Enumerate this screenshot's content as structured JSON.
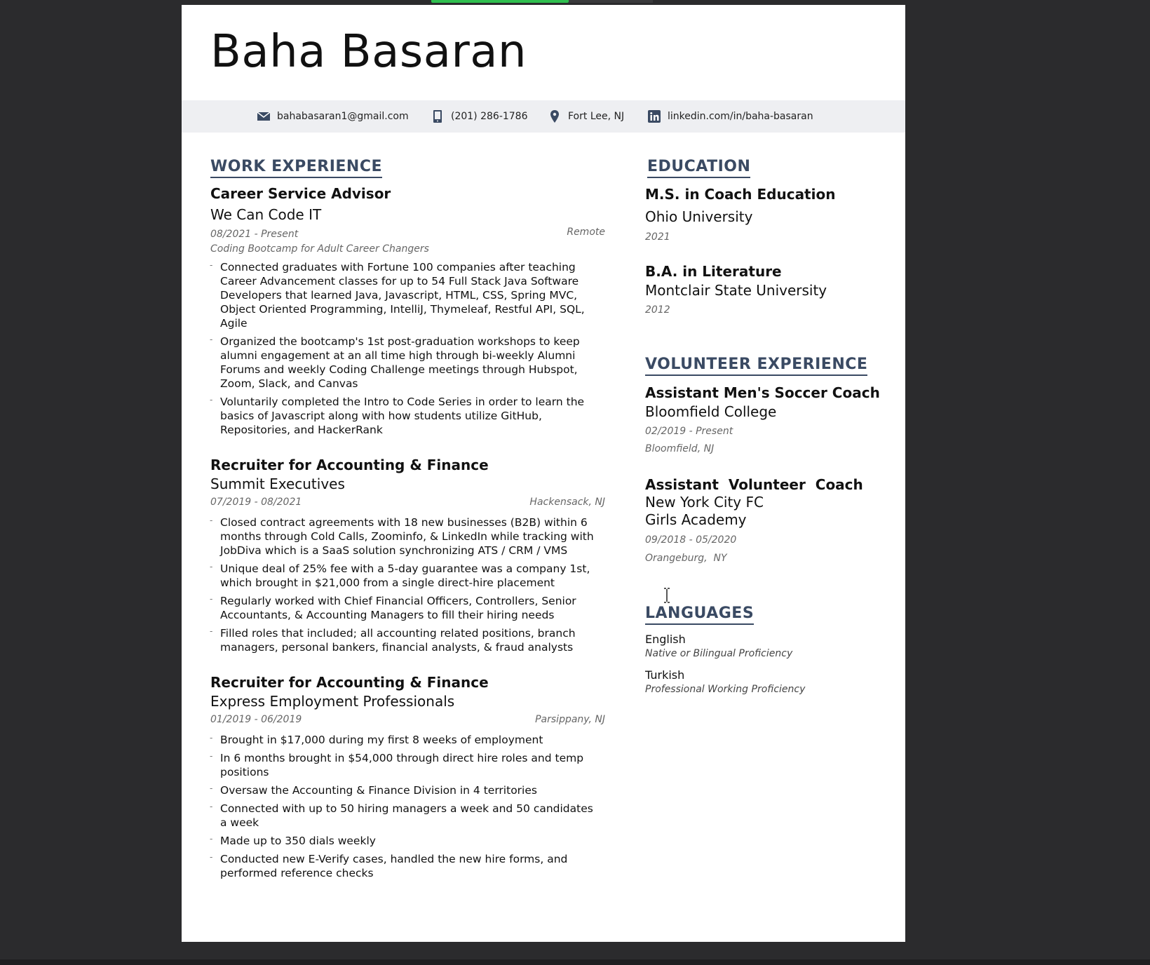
{
  "resume": {
    "name": "Baha Basaran",
    "contact": {
      "email": "bahabasaran1@gmail.com",
      "phone": "(201) 286-1786",
      "location": "Fort Lee, NJ",
      "linkedin": "linkedin.com/in/baha-basaran"
    },
    "work": {
      "heading": "WORK EXPERIENCE",
      "jobs": [
        {
          "title": "Career Service Advisor",
          "company": "We Can Code IT",
          "dates": "08/2021 - Present",
          "location": "Remote",
          "description": "Coding Bootcamp for Adult Career Changers",
          "bullets": [
            "Connected graduates with Fortune 100 companies after teaching Career Advancement classes for up to 54 Full Stack Java Software Developers that learned Java, Javascript, HTML, CSS, Spring MVC, Object Oriented Programming, IntelliJ, Thymeleaf, Restful API, SQL, Agile",
            "Organized the bootcamp's 1st post-graduation workshops to keep alumni engagement at an all time high through bi-weekly Alumni Forums and weekly Coding Challenge meetings through Hubspot, Zoom, Slack, and Canvas",
            "Voluntarily completed the Intro to Code Series in order to learn the basics of Javascript along with how students utilize GitHub, Repositories, and HackerRank"
          ]
        },
        {
          "title": "Recruiter for Accounting & Finance",
          "company": "Summit Executives",
          "dates": "07/2019 - 08/2021",
          "location": "Hackensack, NJ",
          "bullets": [
            "Closed contract agreements with 18 new businesses (B2B) within 6 months through Cold Calls, Zoominfo, & LinkedIn while tracking with JobDiva which is a SaaS solution synchronizing ATS / CRM / VMS",
            "Unique deal of 25% fee with a 5-day guarantee was a company 1st, which brought in $21,000 from a single direct-hire placement",
            "Regularly worked with Chief Financial Officers, Controllers, Senior Accountants, & Accounting Managers to fill their hiring needs",
            "Filled roles that included; all accounting related positions, branch managers, personal bankers, financial analysts, & fraud analysts"
          ]
        },
        {
          "title": "Recruiter for Accounting & Finance",
          "company": "Express Employment Professionals",
          "dates": "01/2019 - 06/2019",
          "location": "Parsippany, NJ",
          "bullets": [
            "Brought in $17,000 during my first 8 weeks of employment",
            "In 6 months brought in $54,000 through direct hire roles and temp positions",
            "Oversaw the Accounting & Finance Division in 4 territories",
            "Connected with up to 50 hiring managers a week and 50 candidates a week",
            "Made up to 350 dials weekly",
            "Conducted new E-Verify cases, handled the new hire forms, and performed reference checks"
          ]
        }
      ]
    },
    "education": {
      "heading": "EDUCATION",
      "items": [
        {
          "degree": "M.S. in Coach Education",
          "school": "Ohio University",
          "year": "2021"
        },
        {
          "degree": "B.A. in Literature",
          "school": "Montclair State University",
          "year": "2012"
        }
      ]
    },
    "volunteer": {
      "heading": "VOLUNTEER EXPERIENCE",
      "items": [
        {
          "title": "Assistant Men's Soccer Coach",
          "org": "Bloomfield College",
          "dates": "02/2019 - Present",
          "location": "Bloomfield, NJ"
        },
        {
          "title": "Assistant  Volunteer  Coach",
          "org_line1": "New York City FC",
          "org_line2": "Girls Academy",
          "dates": "09/2018 - 05/2020",
          "location": "Orangeburg,  NY"
        }
      ]
    },
    "languages": {
      "heading": "LANGUAGES",
      "items": [
        {
          "name": "English",
          "level": "Native or Bilingual Proficiency"
        },
        {
          "name": "Turkish",
          "level": "Professional Working Proficiency"
        }
      ]
    }
  },
  "icons": {
    "email": "envelope-icon",
    "phone": "phone-icon",
    "location": "map-pin-icon",
    "linkedin": "linkedin-icon",
    "cursor": "text-cursor-icon"
  },
  "colors": {
    "background": "#2b2b2d",
    "page": "#ffffff",
    "accent": "#3a4a63",
    "contact_bar": "#eeeff2",
    "indicator": "#2fbf4f"
  }
}
